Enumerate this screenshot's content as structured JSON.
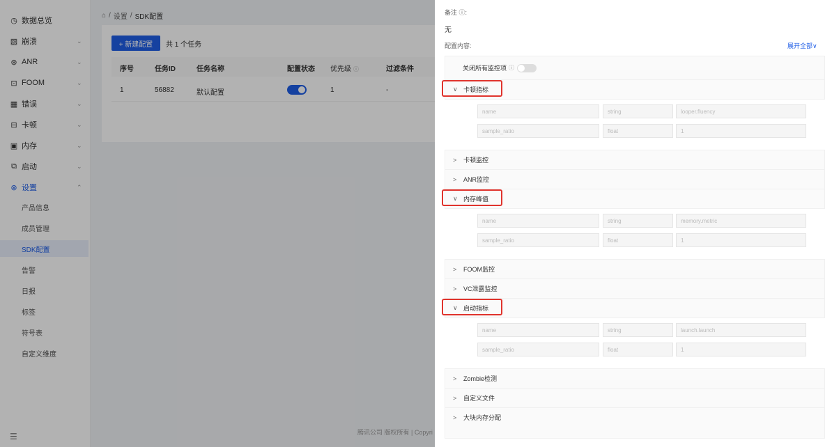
{
  "sidebar": {
    "items": [
      {
        "label": "数据总览",
        "icon": "clock-icon",
        "glyph": "◷",
        "chevron": false
      },
      {
        "label": "崩溃",
        "icon": "crash-icon",
        "glyph": "▧",
        "chevron": true
      },
      {
        "label": "ANR",
        "icon": "anr-icon",
        "glyph": "⊛",
        "chevron": true
      },
      {
        "label": "FOOM",
        "icon": "foom-icon",
        "glyph": "⊡",
        "chevron": true
      },
      {
        "label": "错误",
        "icon": "error-icon",
        "glyph": "▦",
        "chevron": true
      },
      {
        "label": "卡顿",
        "icon": "lag-icon",
        "glyph": "⊟",
        "chevron": true
      },
      {
        "label": "内存",
        "icon": "memory-icon",
        "glyph": "▣",
        "chevron": true
      },
      {
        "label": "启动",
        "icon": "launch-icon",
        "glyph": "⧉",
        "chevron": true
      },
      {
        "label": "设置",
        "icon": "settings-icon",
        "glyph": "⊗",
        "chevron": true,
        "active": true
      }
    ],
    "sub_items": [
      "产品信息",
      "成员管理",
      "SDK配置",
      "告警",
      "日报",
      "标签",
      "符号表",
      "自定义维度"
    ],
    "selected_sub": "SDK配置",
    "collapse_glyph": "☰"
  },
  "breadcrumb": {
    "home_glyph": "⌂",
    "sep": "/",
    "level1": "设置",
    "level2": "SDK配置"
  },
  "toolbar": {
    "new_button": "+ 新建配置",
    "task_count": "共 1 个任务"
  },
  "table": {
    "headers": [
      "序号",
      "任务ID",
      "任务名称",
      "配置状态",
      "优先级",
      "过滤条件"
    ],
    "rows": [
      {
        "index": "1",
        "task_id": "56882",
        "name": "默认配置",
        "enabled": true,
        "priority": "1",
        "filter": "-"
      }
    ]
  },
  "footer": "腾讯公司 版权所有 | Copyri",
  "drawer": {
    "remark_label": "备注 ⓘ:",
    "remark_value": "无",
    "config_label": "配置内容:",
    "expand_all": "展开全部∨",
    "close_all_label": "关闭所有监控项",
    "sections": [
      {
        "title": "卡顿指标",
        "expanded": true,
        "highlighted": true,
        "rows": [
          [
            "name",
            "string",
            "looper.fluency"
          ],
          [
            "sample_ratio",
            "float",
            "1"
          ]
        ]
      },
      {
        "title": "卡顿监控",
        "expanded": false
      },
      {
        "title": "ANR监控",
        "expanded": false
      },
      {
        "title": "内存峰值",
        "expanded": true,
        "highlighted": true,
        "rows": [
          [
            "name",
            "string",
            "memory.metric"
          ],
          [
            "sample_ratio",
            "float",
            "1"
          ]
        ]
      },
      {
        "title": "FOOM监控",
        "expanded": false
      },
      {
        "title": "VC泄露监控",
        "expanded": false
      },
      {
        "title": "启动指标",
        "expanded": true,
        "highlighted": true,
        "rows": [
          [
            "name",
            "string",
            "launch.launch"
          ],
          [
            "sample_ratio",
            "float",
            "1"
          ]
        ]
      },
      {
        "title": "Zombie检测",
        "expanded": false
      },
      {
        "title": "自定义文件",
        "expanded": false
      },
      {
        "title": "大块内存分配",
        "expanded": false
      }
    ]
  },
  "colors": {
    "accent": "#1f5ee6",
    "highlight": "#e0342d"
  }
}
